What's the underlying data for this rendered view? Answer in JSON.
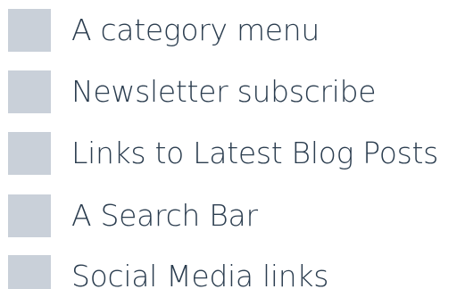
{
  "box_color": "#c9d0d9",
  "text_color": "#2b3d4f",
  "items": [
    {
      "label": "A category menu"
    },
    {
      "label": "Newsletter subscribe"
    },
    {
      "label": "Links to Latest Blog Posts"
    },
    {
      "label": "A Search Bar"
    },
    {
      "label": "Social Media links"
    }
  ]
}
